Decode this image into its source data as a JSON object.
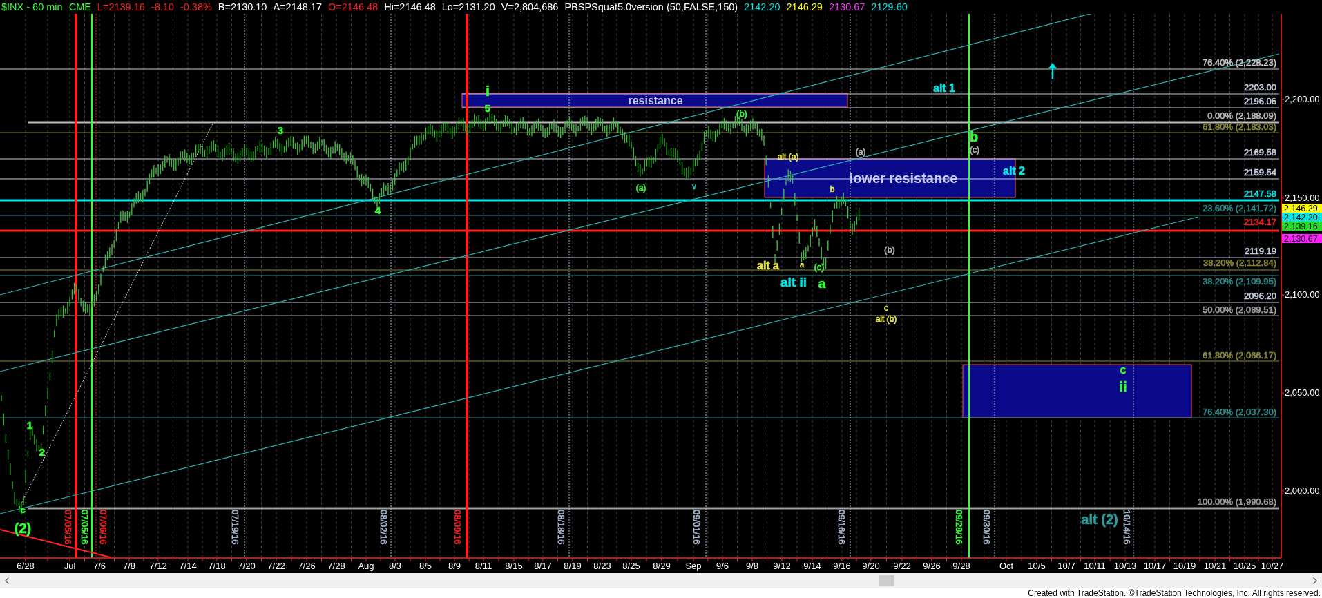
{
  "legend": [
    {
      "text": "$INX - 60 min",
      "color": "#33ff33"
    },
    {
      "text": "CME",
      "color": "#33ff33"
    },
    {
      "text": "L=2139.16",
      "color": "#ff2020"
    },
    {
      "text": "-8.10",
      "color": "#ff2020"
    },
    {
      "text": "-0.38%",
      "color": "#ff2020"
    },
    {
      "text": "B=2130.10",
      "color": "#ffffff"
    },
    {
      "text": "A=2148.17",
      "color": "#ffffff"
    },
    {
      "text": "O=2146.48",
      "color": "#ff2020"
    },
    {
      "text": "Hi=2146.48",
      "color": "#ffffff"
    },
    {
      "text": "Lo=2131.20",
      "color": "#ffffff"
    },
    {
      "text": "V=2,804,686",
      "color": "#ffffff"
    },
    {
      "text": "PBSPSquat5.0version (50,FALSE,150)",
      "color": "#ffffff"
    },
    {
      "text": "2142.20",
      "color": "#00e5e5"
    },
    {
      "text": "2146.29",
      "color": "#ffff00"
    },
    {
      "text": "2130.67",
      "color": "#ff33ff"
    },
    {
      "text": "2129.60",
      "color": "#00e5e5"
    }
  ],
  "price_levels": [
    {
      "label": "76.40% (2,228.23)",
      "color": "#c8c8c8"
    },
    {
      "label": "2203.00",
      "color": "#c8cde0"
    },
    {
      "label": "2196.06",
      "color": "#c8cde0"
    },
    {
      "label": "0.00% (2,188.09)",
      "color": "#bdbdbd"
    },
    {
      "label": "61.80% (2,183.03)",
      "color": "#8a8a36"
    },
    {
      "label": "2169.58",
      "color": "#c8cde0"
    },
    {
      "label": "2159.54",
      "color": "#c8cde0"
    },
    {
      "label": "2147.58",
      "color": "#00e5e5"
    },
    {
      "label": "23.60% (2,141.72)",
      "color": "#2e8b8b"
    },
    {
      "label": "2134.17",
      "color": "#ff2020"
    },
    {
      "label": "2119.19",
      "color": "#c8cde0"
    },
    {
      "label": "38.20% (2,112.84)",
      "color": "#8a8a36"
    },
    {
      "label": "38.20% (2,109.95)",
      "color": "#2e8b8b"
    },
    {
      "label": "2096.20",
      "color": "#c8cde0"
    },
    {
      "label": "50.00% (2,089.51)",
      "color": "#a0a0a0"
    },
    {
      "label": "61.80% (2,066.17)",
      "color": "#8a8a36"
    },
    {
      "label": "76.40% (2,037.30)",
      "color": "#2e8b8b"
    },
    {
      "label": "100.00% (1,990.68)",
      "color": "#a0a0a0"
    }
  ],
  "zones": [
    {
      "label": "resistance"
    },
    {
      "label": "lower resistance"
    }
  ],
  "wave_labels": [
    {
      "text": "i",
      "color": "#33ff33"
    },
    {
      "text": "5",
      "color": "#33ff33"
    },
    {
      "text": "3",
      "color": "#33ff33"
    },
    {
      "text": "4",
      "color": "#33ff33"
    },
    {
      "text": "1",
      "color": "#33ff33"
    },
    {
      "text": "2",
      "color": "#33ff33"
    },
    {
      "text": "c",
      "color": "#33ff33"
    },
    {
      "text": "(2)",
      "color": "#33ff33"
    },
    {
      "text": "(b)",
      "color": "#33ff33"
    },
    {
      "text": "(a)",
      "color": "#33ff33"
    },
    {
      "text": "v",
      "color": "#2eb8b8"
    },
    {
      "text": "alt (a)",
      "color": "#e6e64d"
    },
    {
      "text": "(a)",
      "color": "#b4b4b4"
    },
    {
      "text": "b",
      "color": "#e6e64d"
    },
    {
      "text": "(b)",
      "color": "#b4b4b4"
    },
    {
      "text": "alt a",
      "color": "#e6e64d"
    },
    {
      "text": "a",
      "color": "#e6e64d"
    },
    {
      "text": "(c)",
      "color": "#33ff33"
    },
    {
      "text": "alt ii",
      "color": "#00e5e5"
    },
    {
      "text": "a",
      "color": "#33ff33"
    },
    {
      "text": "c",
      "color": "#e6e64d"
    },
    {
      "text": "alt (b)",
      "color": "#e6e64d"
    },
    {
      "text": "alt 1",
      "color": "#00e5e5"
    },
    {
      "text": "b",
      "color": "#33ff33"
    },
    {
      "text": "(c)",
      "color": "#b4b4b4"
    },
    {
      "text": "alt 2",
      "color": "#00e5e5"
    },
    {
      "text": "c",
      "color": "#33ff33"
    },
    {
      "text": "ii",
      "color": "#33ff33"
    },
    {
      "text": "alt (2)",
      "color": "#2a9d9d"
    }
  ],
  "date_markers": [
    {
      "text": "07/05/16",
      "color": "#ff2020"
    },
    {
      "text": "07/05/16",
      "color": "#33ff33"
    },
    {
      "text": "07/06/16",
      "color": "#ff2020"
    },
    {
      "text": "07/19/16",
      "color": "#a8b8d0"
    },
    {
      "text": "08/02/16",
      "color": "#a8b8d0"
    },
    {
      "text": "08/09/16",
      "color": "#ff2020"
    },
    {
      "text": "08/18/16",
      "color": "#a8b8d0"
    },
    {
      "text": "09/01/16",
      "color": "#a8b8d0"
    },
    {
      "text": "09/16/16",
      "color": "#a8b8d0"
    },
    {
      "text": "09/28/16",
      "color": "#33ff33"
    },
    {
      "text": "09/30/16",
      "color": "#a8b8d0"
    },
    {
      "text": "10/14/16",
      "color": "#a8b8d0"
    }
  ],
  "price_axis": {
    "ticks": [
      "2,200.00",
      "2,150.00",
      "2,100.00",
      "2,050.00",
      "2,000.00"
    ],
    "tags": [
      {
        "text": "2,146.29",
        "color": "#ffff00"
      },
      {
        "text": "2,142.20",
        "color": "#00e5e5"
      },
      {
        "text": "2,139.16",
        "color": "#22dd22"
      },
      {
        "text": "2,130.67",
        "color": "#ff22ff"
      }
    ]
  },
  "time_axis": [
    "6/28",
    "Jul",
    "7/6",
    "7/8",
    "7/12",
    "7/14",
    "7/18",
    "7/20",
    "7/22",
    "7/26",
    "7/28",
    "Aug",
    "8/3",
    "8/5",
    "8/9",
    "8/11",
    "8/15",
    "8/17",
    "8/19",
    "8/23",
    "8/25",
    "8/29",
    "Sep",
    "9/6",
    "9/8",
    "9/12",
    "9/14",
    "9/16",
    "9/20",
    "9/22",
    "9/26",
    "9/28",
    "Oct",
    "10/5",
    "10/7",
    "10/11",
    "10/13",
    "10/17",
    "10/19",
    "10/21",
    "10/25",
    "10/27"
  ],
  "footer": "Created with TradeStation. ©TradeStation Technologies, Inc. All rights reserved."
}
